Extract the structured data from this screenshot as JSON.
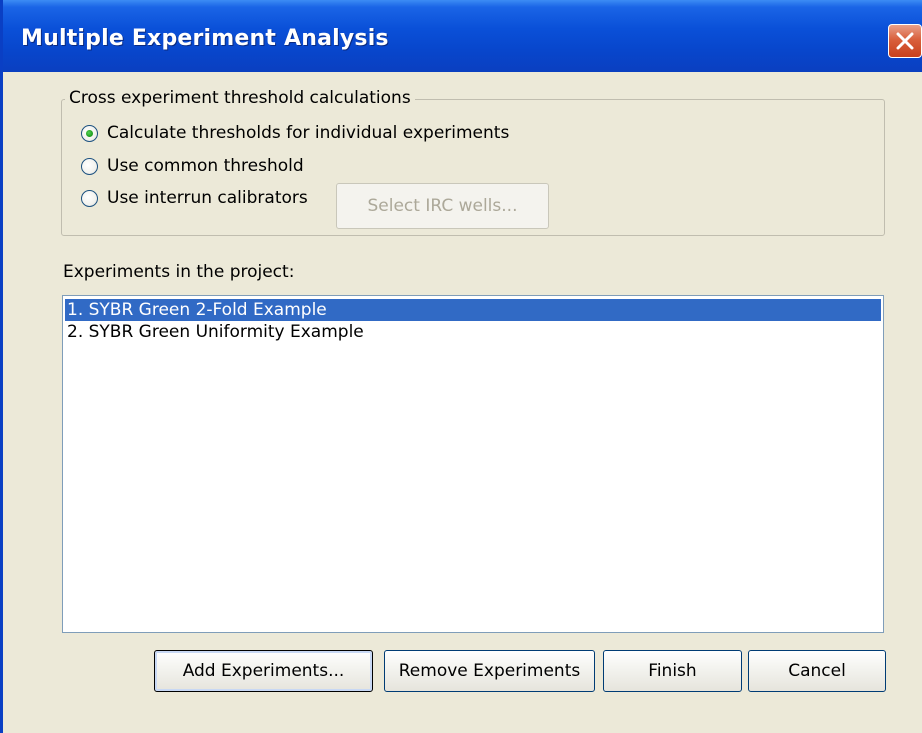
{
  "window": {
    "title": "Multiple Experiment Analysis"
  },
  "threshold_group": {
    "legend": "Cross experiment threshold calculations",
    "options": [
      {
        "label": "Calculate thresholds for individual experiments",
        "checked": true
      },
      {
        "label": "Use common threshold",
        "checked": false
      },
      {
        "label": "Use interrun calibrators",
        "checked": false
      }
    ],
    "irc_button_label": "Select IRC wells..."
  },
  "experiments": {
    "label": "Experiments in the project:",
    "items": [
      {
        "text": "1. SYBR Green 2-Fold Example",
        "selected": true
      },
      {
        "text": "2. SYBR Green Uniformity Example",
        "selected": false
      }
    ]
  },
  "buttons": {
    "add": "Add Experiments...",
    "remove": "Remove Experiments",
    "finish": "Finish",
    "cancel": "Cancel"
  },
  "colors": {
    "titlebar": "#0a50d8",
    "selection": "#316ac5",
    "dialog_bg": "#ece9d8",
    "close_button": "#d9603c"
  }
}
